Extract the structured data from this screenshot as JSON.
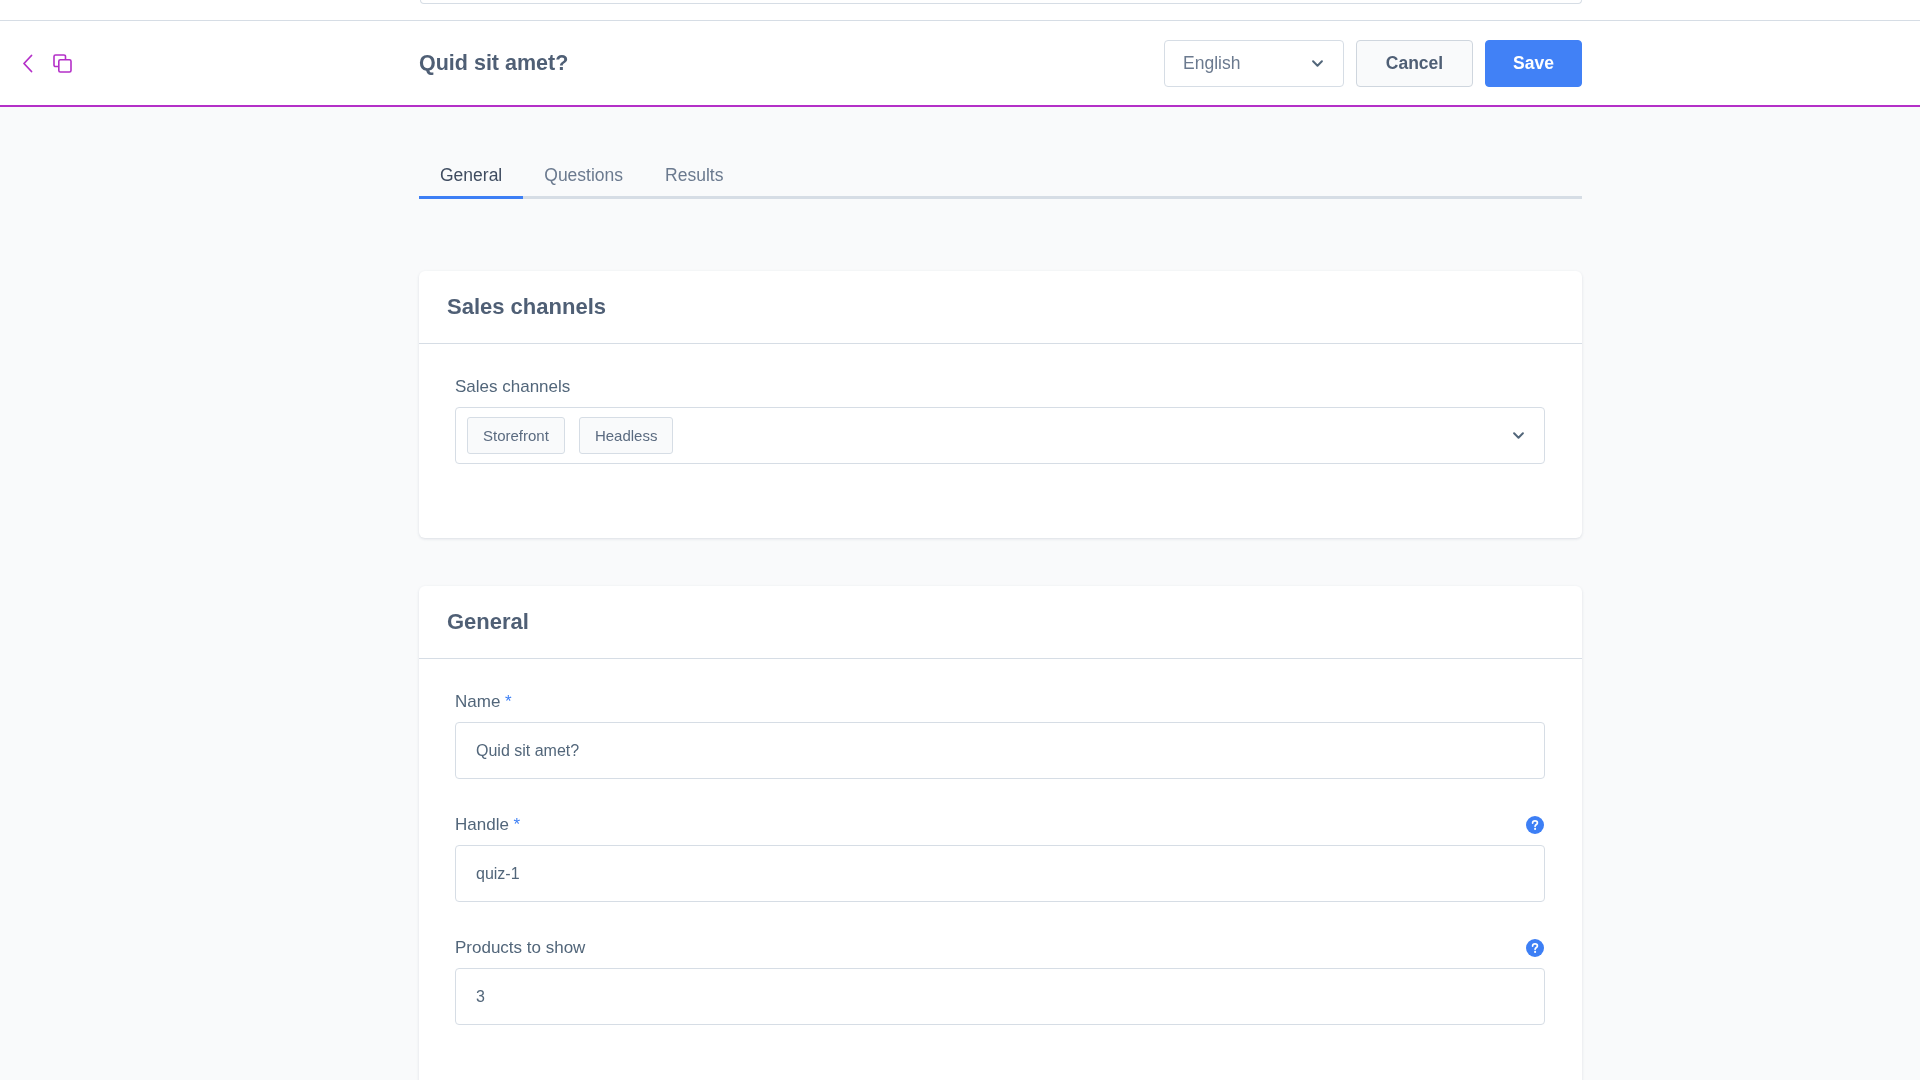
{
  "header": {
    "title": "Quid sit amet?",
    "language": "English",
    "buttons": [
      {
        "label": "Cancel",
        "kind": "secondary"
      },
      {
        "label": "Save",
        "kind": "primary"
      }
    ]
  },
  "tabs": [
    {
      "label": "General",
      "selected": true
    },
    {
      "label": "Questions",
      "selected": false
    },
    {
      "label": "Results",
      "selected": false
    }
  ],
  "cards": [
    {
      "title": "Sales channels",
      "fields": [
        {
          "kind": "multiselect",
          "label": "Sales channels",
          "tags": [
            "Storefront",
            "Headless"
          ]
        }
      ]
    },
    {
      "title": "General",
      "fields": [
        {
          "kind": "text",
          "label": "Name",
          "required_mark": "*",
          "value": "Quid sit amet?",
          "help": false
        },
        {
          "kind": "text",
          "label": "Handle",
          "required_mark": "*",
          "value": "quiz-1",
          "help": true
        },
        {
          "kind": "text",
          "label": "Products to show",
          "value": "3",
          "help": true
        }
      ]
    }
  ]
}
